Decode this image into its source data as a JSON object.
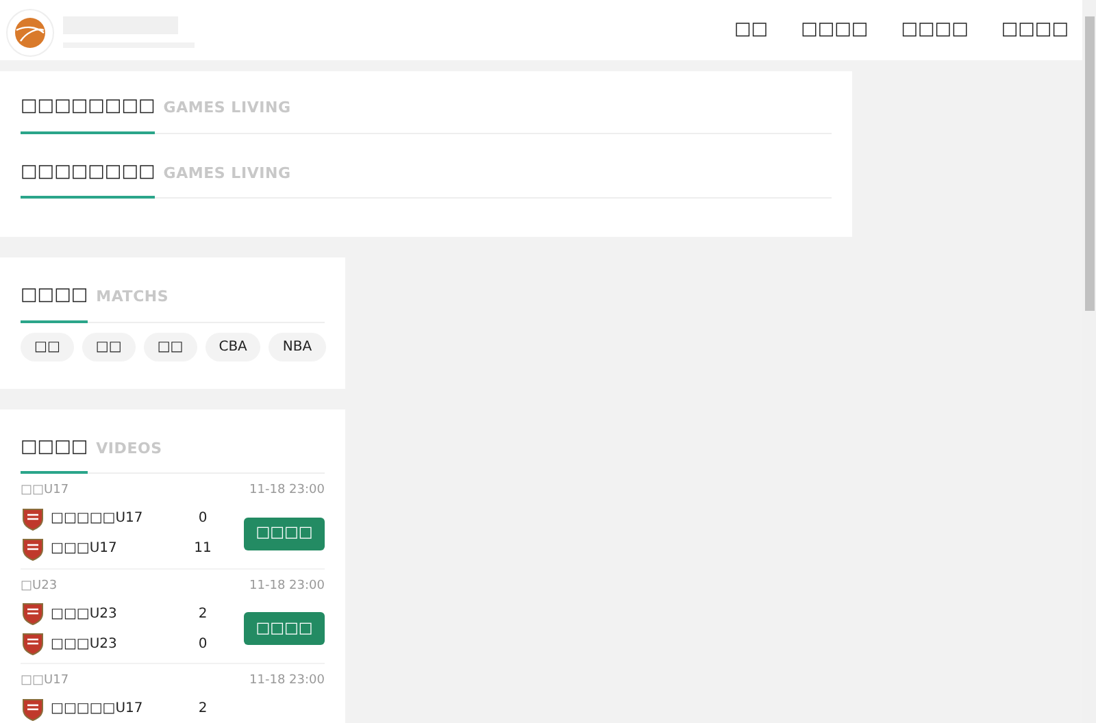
{
  "nav": [
    {
      "label": "□□"
    },
    {
      "label": "□□□□"
    },
    {
      "label": "□□□□"
    },
    {
      "label": "□□□□"
    }
  ],
  "live_sections": [
    {
      "title": "□□□□□□□□",
      "subtitle": "GAMES LIVING"
    },
    {
      "title": "□□□□□□□□",
      "subtitle": "GAMES LIVING"
    }
  ],
  "matchs": {
    "title": "□□□□",
    "subtitle": "MATCHS",
    "tags": [
      "□□",
      "□□",
      "□□",
      "CBA",
      "NBA"
    ]
  },
  "videos": {
    "title": "□□□□",
    "subtitle": "VIDEOS",
    "matches": [
      {
        "league": "□□U17",
        "time": "11-18 23:00",
        "teams": [
          {
            "name": "□□□□□U17",
            "score": "0"
          },
          {
            "name": "□□□U17",
            "score": "11"
          }
        ],
        "button": "□□□□"
      },
      {
        "league": "□U23",
        "time": "11-18 23:00",
        "teams": [
          {
            "name": "□□□U23",
            "score": "2"
          },
          {
            "name": "□□□U23",
            "score": "0"
          }
        ],
        "button": "□□□□"
      },
      {
        "league": "□□U17",
        "time": "11-18 23:00",
        "teams": [
          {
            "name": "□□□□□U17",
            "score": "2"
          }
        ]
      }
    ]
  }
}
